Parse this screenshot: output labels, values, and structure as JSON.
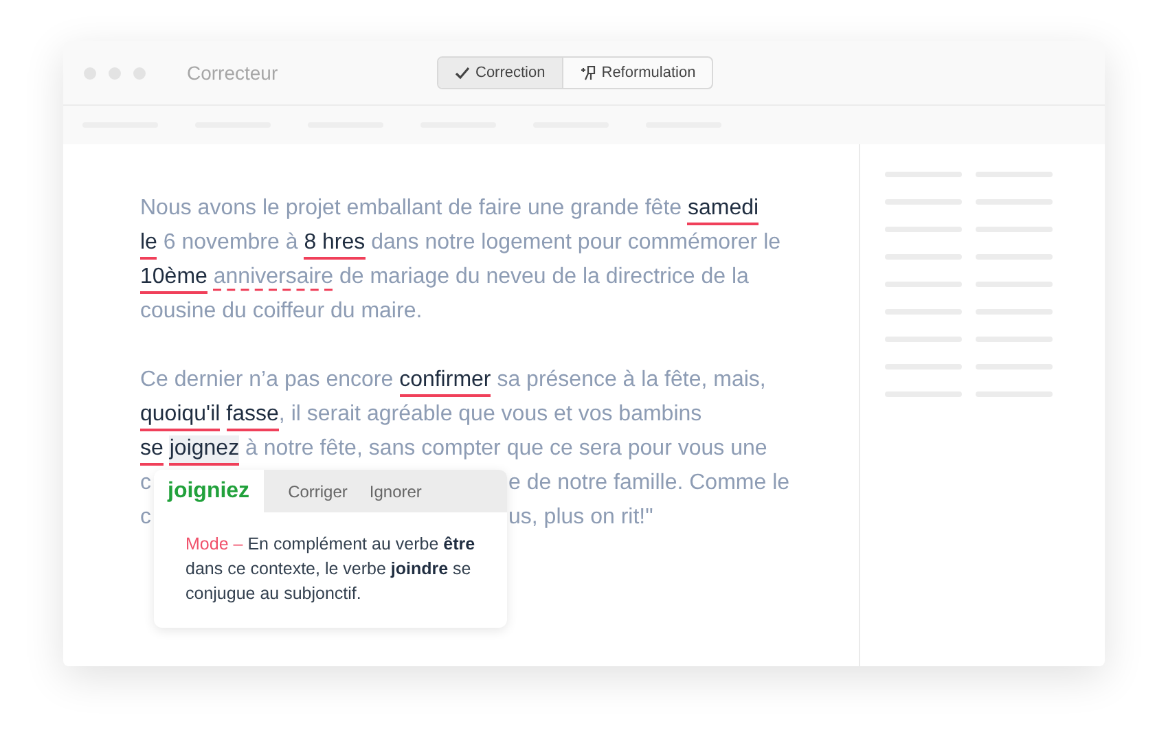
{
  "window": {
    "title": "Correcteur"
  },
  "tabs": [
    {
      "label": "Correction",
      "selected": true,
      "kind": "check"
    },
    {
      "label": "Reformulation",
      "selected": false,
      "kind": "wand"
    }
  ],
  "document": {
    "paragraphs": [
      {
        "lines": [
          {
            "segments": [
              {
                "text": "Nous avons le projet emballant de faire une grande fête ",
                "kind": "plain"
              },
              {
                "text": "samedi",
                "kind": "error",
                "selected": false
              }
            ]
          },
          {
            "segments": [
              {
                "text": "le",
                "kind": "error",
                "selected": false
              },
              {
                "text": " 6 novembre à ",
                "kind": "plain"
              },
              {
                "text": "8 hres",
                "kind": "error",
                "selected": false
              },
              {
                "text": " dans notre logement pour commémorer le",
                "kind": "plain"
              }
            ]
          },
          {
            "segments": [
              {
                "text": "10ème",
                "kind": "error",
                "selected": false
              },
              {
                "text": "anniversaire",
                "kind": "style",
                "space_before": true
              },
              {
                "text": " de mariage du neveu de la directrice de la",
                "kind": "plain"
              }
            ]
          },
          {
            "segments": [
              {
                "text": "cousine du coiffeur du maire.",
                "kind": "plain"
              }
            ]
          }
        ]
      },
      {
        "lines": [
          {
            "segments": [
              {
                "text": "Ce dernier n’a pas encore ",
                "kind": "plain"
              },
              {
                "text": "confirmer",
                "kind": "error",
                "selected": false
              },
              {
                "text": " sa présence à la fête, mais,",
                "kind": "plain"
              }
            ]
          },
          {
            "segments": [
              {
                "text": "quoiqu'il",
                "kind": "error",
                "selected": false
              },
              {
                "text": "fasse",
                "kind": "error",
                "selected": false,
                "space_before": true
              },
              {
                "text": ", il serait agréable que vous et vos bambins",
                "kind": "plain"
              }
            ]
          },
          {
            "segments": [
              {
                "text": "se",
                "kind": "error",
                "selected": false
              },
              {
                "text": "joignez",
                "kind": "error",
                "selected": true,
                "space_before": true
              },
              {
                "text": " à notre fête, sans compter que ce sera pour vous une",
                "kind": "plain"
              }
            ]
          },
          {
            "segments": [
              {
                "text": "c",
                "kind": "plain"
              }
            ],
            "after_popup": "e de notre famille. Comme le"
          },
          {
            "segments": [
              {
                "text": "c",
                "kind": "plain"
              }
            ],
            "after_popup": "us, plus on rit!\""
          }
        ]
      }
    ]
  },
  "popup": {
    "word": "joigniez",
    "actions": [
      "Corriger",
      "Ignorer"
    ],
    "label": "Mode –",
    "explanation": "En complément au verbe **être** dans ce contexte, le verbe **joindre** se conjugue au subjonctif."
  }
}
